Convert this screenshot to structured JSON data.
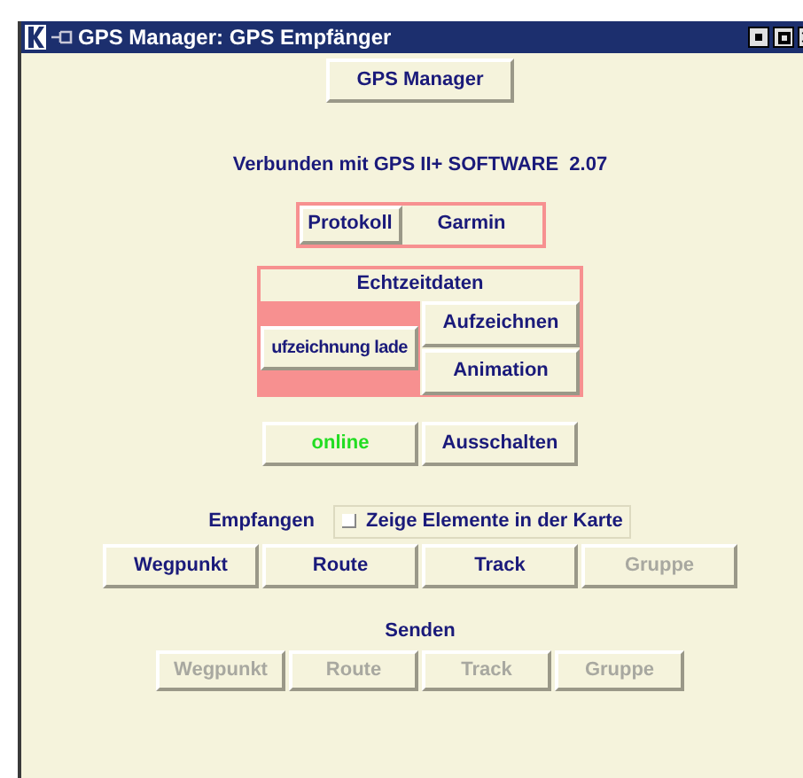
{
  "window": {
    "title": "GPS Manager: GPS Empfänger"
  },
  "header_button": {
    "label": "GPS Manager"
  },
  "connection_text": "Verbunden mit GPS II+ SOFTWARE  2.07",
  "protocol": {
    "button": "Protokoll",
    "value": "Garmin"
  },
  "realtime": {
    "title": "Echtzeitdaten",
    "load_button": "ufzeichnung lade",
    "buttons": [
      "Aufzeichnen",
      "Animation"
    ]
  },
  "status": {
    "label": "online",
    "online": true,
    "toggle_button": "Ausschalten"
  },
  "receive": {
    "label": "Empfangen",
    "show_on_map": {
      "label": "Zeige Elemente in der Karte",
      "checked": false
    },
    "buttons": [
      {
        "label": "Wegpunkt",
        "disabled": false
      },
      {
        "label": "Route",
        "disabled": false
      },
      {
        "label": "Track",
        "disabled": false
      },
      {
        "label": "Gruppe",
        "disabled": true
      }
    ]
  },
  "send": {
    "label": "Senden",
    "buttons": [
      {
        "label": "Wegpunkt",
        "disabled": true
      },
      {
        "label": "Route",
        "disabled": true
      },
      {
        "label": "Track",
        "disabled": true
      },
      {
        "label": "Gruppe",
        "disabled": true
      }
    ]
  }
}
